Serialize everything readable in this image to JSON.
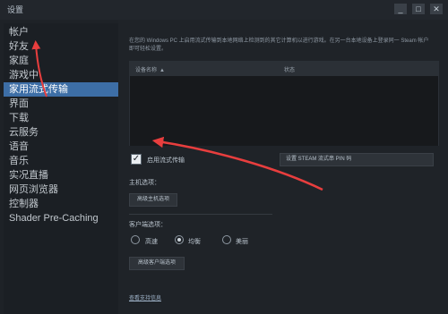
{
  "window": {
    "title": "设置",
    "controls": [
      "_",
      "□",
      "✕"
    ]
  },
  "sidebar": {
    "items": [
      {
        "label": "帐户"
      },
      {
        "label": "好友"
      },
      {
        "label": "家庭"
      },
      {
        "label": "游戏中"
      },
      {
        "label": "家用流式传输",
        "active": true
      },
      {
        "label": "界面"
      },
      {
        "label": "下载"
      },
      {
        "label": "云服务"
      },
      {
        "label": "语音"
      },
      {
        "label": "音乐"
      },
      {
        "label": "实况直播"
      },
      {
        "label": "网页浏览器"
      },
      {
        "label": "控制器"
      },
      {
        "label": "Shader Pre-Caching"
      }
    ]
  },
  "main": {
    "description": "在您的 Windows PC 上启用流式传输到本地网络上检测到的其它计算机以进行游戏。在另一台本地设备上登录同一 Steam 帐户即可轻松设置。",
    "table": {
      "col_name": "设备名称",
      "col_status": "状态"
    },
    "enable_streaming": {
      "label": "启用流式传输",
      "checked": true
    },
    "pin_button": "设置 STEAM 流式串 PIN 码",
    "host_options": {
      "label": "主机选项：",
      "button": "高级主机选项"
    },
    "client_options": {
      "label": "客户端选项：",
      "radios": [
        {
          "label": "高速",
          "selected": false
        },
        {
          "label": "均衡",
          "selected": true
        },
        {
          "label": "美丽",
          "selected": false
        }
      ],
      "button": "高级客户端选项"
    },
    "support_link": "查看支持信息"
  },
  "colors": {
    "accent": "#3d6ea6",
    "annotation": "#e83e3e"
  }
}
